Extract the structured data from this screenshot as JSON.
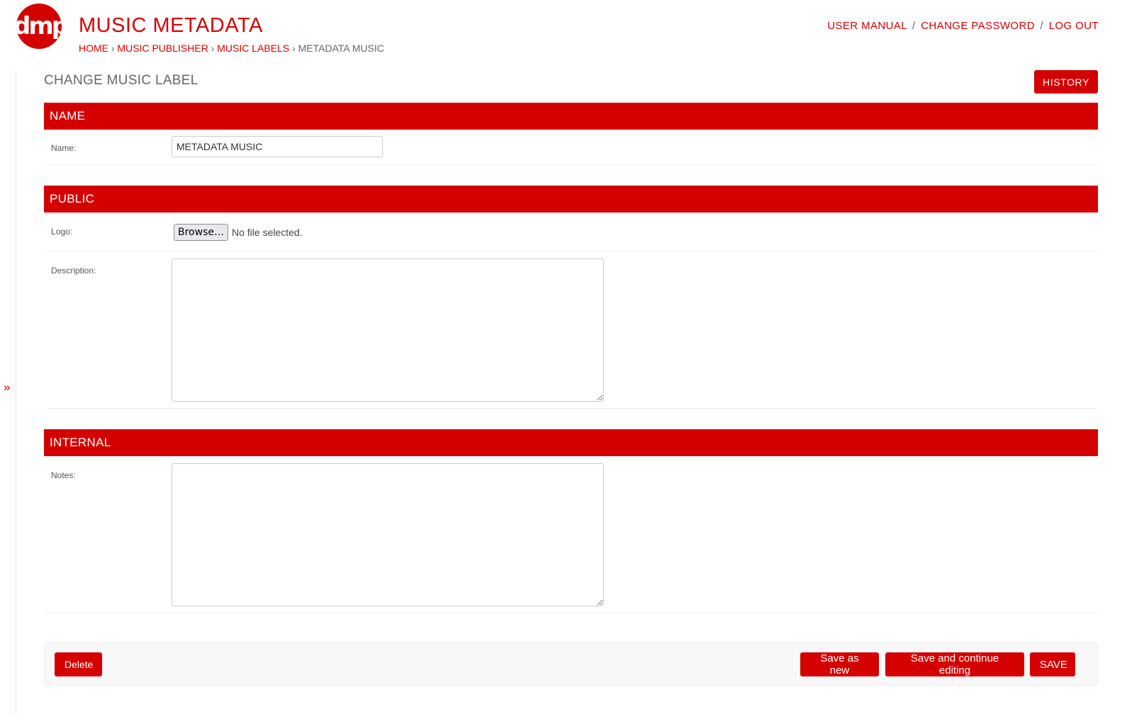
{
  "header": {
    "logo_text": "dmp",
    "site_title": "MUSIC METADATA",
    "breadcrumbs": {
      "home": "HOME",
      "sep": "›",
      "app": "MUSIC PUBLISHER",
      "model": "MUSIC LABELS",
      "current": "METADATA MUSIC"
    },
    "usertools": {
      "manual": "USER MANUAL",
      "change_password": "CHANGE PASSWORD",
      "logout": "LOG OUT",
      "sep": "/"
    }
  },
  "nav": {
    "toggle_glyph": "»"
  },
  "page": {
    "title": "CHANGE MUSIC LABEL",
    "history_label": "HISTORY"
  },
  "fieldsets": {
    "name": {
      "title": "NAME",
      "name_label": "Name:",
      "name_value": "METADATA MUSIC"
    },
    "public": {
      "title": "PUBLIC",
      "logo_label": "Logo:",
      "browse_label": "Browse…",
      "file_status": "No file selected.",
      "description_label": "Description:",
      "description_value": ""
    },
    "internal": {
      "title": "INTERNAL",
      "notes_label": "Notes:",
      "notes_value": ""
    }
  },
  "actions": {
    "delete": "Delete",
    "save_as_new": "Save as new",
    "save_continue": "Save and continue editing",
    "save": "SAVE"
  },
  "colors": {
    "accent": "#d40000",
    "text_muted": "#666666",
    "border": "#cccccc"
  }
}
